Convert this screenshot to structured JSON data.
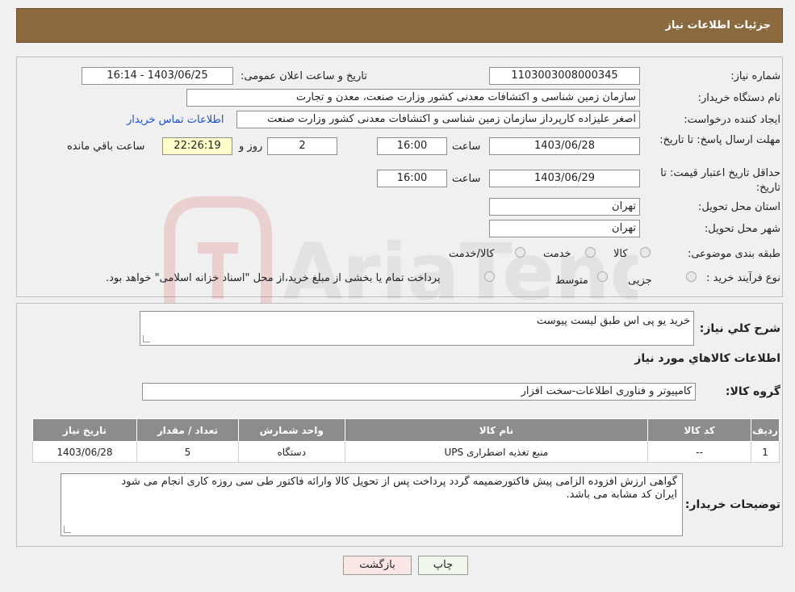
{
  "header": {
    "title": "جزئیات اطلاعات نیاز"
  },
  "watermark": {
    "text": "AriaTender.neT"
  },
  "form": {
    "need_number_label": "شماره نیاز:",
    "need_number": "1103003008000345",
    "announce_label": "تاریخ و ساعت اعلان عمومی:",
    "announce_value": "1403/06/25 - 16:14",
    "buyer_org_label": "نام دستگاه خریدار:",
    "buyer_org": "سازمان زمین شناسی و اکتشافات معدنی کشور وزارت صنعت، معدن و تجارت",
    "creator_label": "ایجاد کننده درخواست:",
    "creator": "اصغر علیزاده کارپرداز سازمان زمین شناسی و اکتشافات معدنی کشور وزارت صنعت",
    "contact_link": "اطلاعات تماس خریدار",
    "deadline_label": "مهلت ارسال پاسخ: تا تاریخ:",
    "deadline_date": "1403/06/28",
    "time_label": "ساعت",
    "deadline_time": "16:00",
    "days_value": "2",
    "days_label": "روز و",
    "remaining_time": "22:26:19",
    "remaining_label": "ساعت باقي مانده",
    "validity_label": "حداقل تاریخ اعتبار قیمت: تا تاریخ:",
    "validity_date": "1403/06/29",
    "validity_time": "16:00",
    "province_label": "استان محل تحویل:",
    "province": "تهران",
    "city_label": "شهر محل تحویل:",
    "city": "تهران",
    "category_label": "طبقه بندی موضوعی:",
    "category_options": [
      "کالا",
      "خدمت",
      "کالا/خدمت"
    ],
    "process_label": "نوع فرآیند خرید :",
    "process_options": [
      "جزیی",
      "متوسط"
    ],
    "payment_note": "پرداخت تمام یا بخشی از مبلغ خرید،از محل \"اسناد خزانه اسلامی\" خواهد بود."
  },
  "details": {
    "summary_label": "شرح کلي نياز:",
    "summary": "خرید یو پی اس طبق لیست پیوست",
    "goods_info_title": "اطلاعات کالاهاي مورد نياز",
    "group_label": "گروه کالا:",
    "group": "کامپیوتر و فناوری اطلاعات-سخت افزار",
    "table": {
      "headers": [
        "ردیف",
        "کد کالا",
        "نام کالا",
        "واحد شمارش",
        "تعداد / مقدار",
        "تاریخ نیاز"
      ],
      "rows": [
        [
          "1",
          "--",
          "منبع تغذیه اضطراری UPS",
          "دستگاه",
          "5",
          "1403/06/28"
        ]
      ]
    },
    "buyer_notes_label": "توضیحات خریدار:",
    "buyer_notes_line1": "گواهی ارزش افزوده الزامی پیش فاکتورضمیمه گردد پرداخت پس از تحویل کالا وارائه فاکتور طی سی روزه کاری انجام می شود",
    "buyer_notes_line2": "ایران کد مشابه می باشد."
  },
  "buttons": {
    "print": "چاپ",
    "back": "بازگشت"
  }
}
